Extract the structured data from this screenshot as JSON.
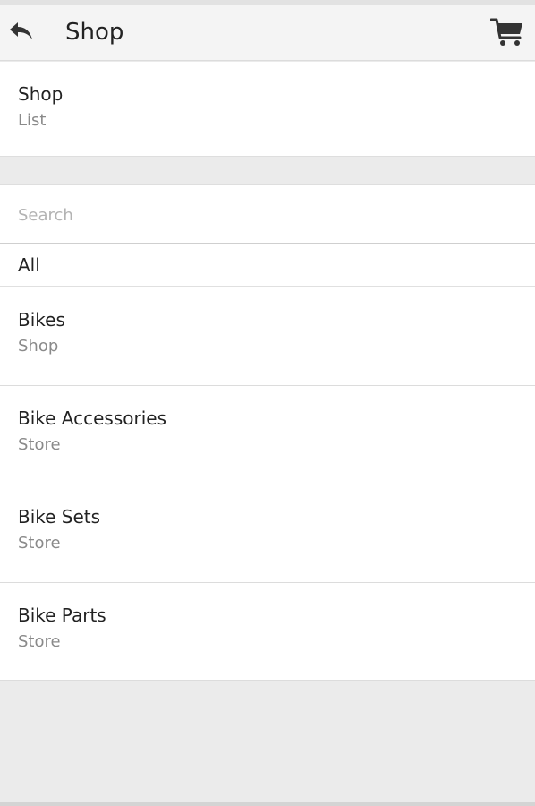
{
  "header": {
    "title": "Shop",
    "back_icon": "reply-arrow-icon",
    "cart_icon": "shopping-cart-icon"
  },
  "info": {
    "title": "Shop",
    "subtitle": "List"
  },
  "search": {
    "placeholder": "Search",
    "value": ""
  },
  "filter": {
    "label": "All"
  },
  "items": [
    {
      "name": "Bikes",
      "type": "Shop"
    },
    {
      "name": "Bike Accessories",
      "type": "Store"
    },
    {
      "name": "Bike Sets",
      "type": "Store"
    },
    {
      "name": "Bike Parts",
      "type": "Store"
    }
  ],
  "colors": {
    "header_bg": "#f4f4f4",
    "page_bg": "#ebebeb",
    "panel_bg": "#ffffff",
    "primary_text": "#222222",
    "secondary_text": "#8a8a8a",
    "icon": "#333333"
  }
}
